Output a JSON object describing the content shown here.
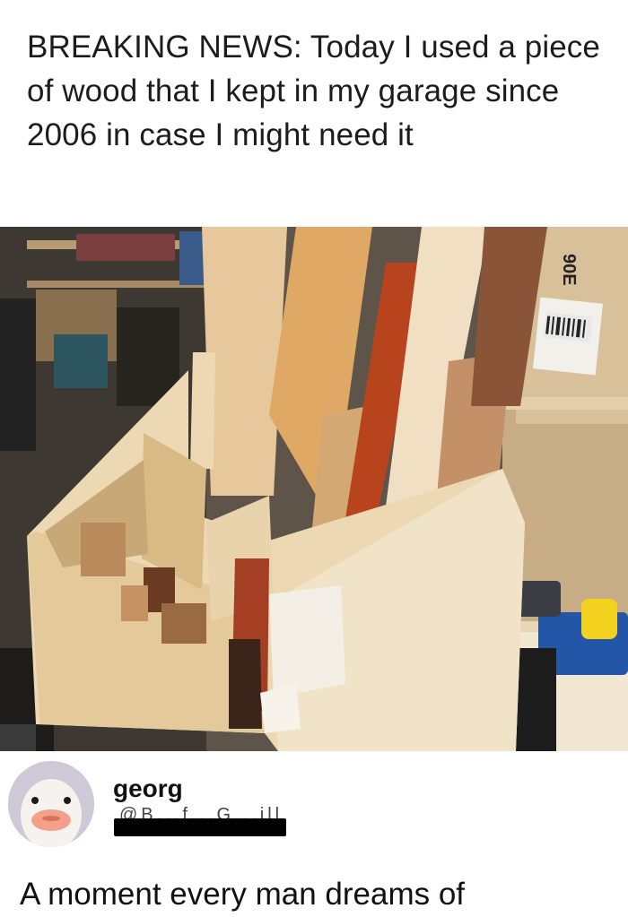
{
  "post": {
    "headline": "BREAKING NEWS: Today I used a piece of wood that I kept in my garage since 2006 in case I might need it"
  },
  "photo": {
    "box_label": "90E"
  },
  "reply": {
    "username": "georg",
    "handle": "@B...f...G...ill",
    "text": "A moment every man dreams of"
  }
}
